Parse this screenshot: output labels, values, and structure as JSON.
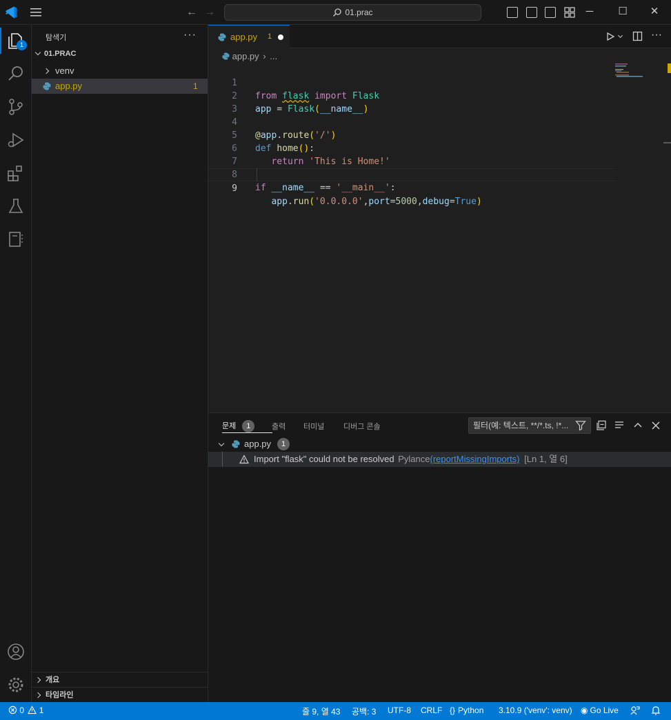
{
  "titlebar": {
    "search_text": "01.prac"
  },
  "activity": {
    "explorer_badge": "1"
  },
  "sidebar": {
    "title": "탐색기",
    "more": "···",
    "folder": "01.PRAC",
    "items": [
      {
        "label": "venv",
        "type": "folder"
      },
      {
        "label": "app.py",
        "type": "file",
        "problems": "1"
      }
    ],
    "outline": "개요",
    "timeline": "타임라인"
  },
  "editor": {
    "tab": {
      "label": "app.py",
      "problems": "1"
    },
    "breadcrumb": {
      "file": "app.py",
      "more": "..."
    },
    "line_numbers": [
      "1",
      "2",
      "3",
      "4",
      "5",
      "6",
      "7",
      "8",
      "9"
    ],
    "code_lines": [
      "from flask import Flask",
      "app = Flask(__name__)",
      "",
      "@app.route('/')",
      "def home():",
      "    return 'This is Home!'",
      "",
      "if __name__ == '__main__':",
      "    app.run('0.0.0.0',port=5000,debug=True)"
    ]
  },
  "panel": {
    "tabs": [
      {
        "label": "문제",
        "count": "1"
      },
      {
        "label": "출력"
      },
      {
        "label": "터미널"
      },
      {
        "label": "디버그 콘솔"
      }
    ],
    "filter_placeholder": "필터(예: 텍스트, **/*.ts, !*...",
    "problem_file": {
      "label": "app.py",
      "count": "1"
    },
    "problem": {
      "message": "Import \"flask\" could not be resolved",
      "source": "Pylance",
      "code": "(reportMissingImports)",
      "location": "[Ln 1, 열 6]"
    }
  },
  "statusbar": {
    "errors": "0",
    "warnings": "1",
    "position": "줄 9, 열 43",
    "spaces": "공백: 3",
    "encoding": "UTF-8",
    "eol": "CRLF",
    "language": "Python",
    "interpreter": "3.10.9 ('venv': venv)",
    "golive": "Go Live"
  },
  "colors": {
    "accent": "#0078d4",
    "warning": "#cca700",
    "background": "#1f1f1f",
    "sidebar": "#181818"
  }
}
